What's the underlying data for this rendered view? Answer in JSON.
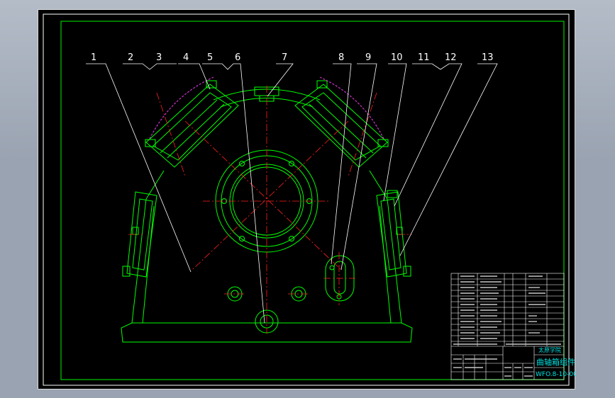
{
  "labels": [
    "1",
    "2",
    "3",
    "4",
    "5",
    "6",
    "7",
    "8",
    "9",
    "10",
    "11",
    "12",
    "13"
  ],
  "title_block": {
    "school": "太原学院",
    "drawing_title": "曲轴箱组件",
    "drawing_number": "WFO.8-10-00"
  },
  "colors": {
    "background": "#000000",
    "frame": "#00cc00",
    "part_outline": "#00ff00",
    "center_line": "#ff2020",
    "hidden_arc": "#cc33cc",
    "leader": "#ffffff",
    "title_text": "#00e5e5"
  }
}
